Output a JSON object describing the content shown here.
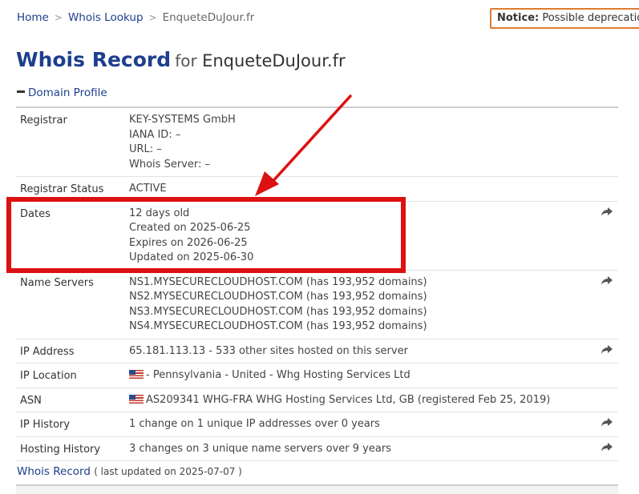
{
  "breadcrumb": {
    "home": "Home",
    "lookup": "Whois Lookup",
    "current": "EnqueteDuJour.fr"
  },
  "notice": {
    "label": "Notice:",
    "text": "Possible deprecation"
  },
  "title": {
    "main": "Whois Record",
    "for": "for",
    "domain": "EnqueteDuJour.fr"
  },
  "section": {
    "label": "Domain Profile"
  },
  "rows": [
    {
      "label": "Registrar",
      "lines": [
        "KEY-SYSTEMS GmbH",
        "IANA ID: –",
        "URL: –",
        "Whois Server: –"
      ],
      "share": false
    },
    {
      "label": "Registrar Status",
      "lines": [
        "ACTIVE"
      ],
      "share": false
    },
    {
      "label": "Dates",
      "lines": [
        "12 days old",
        "Created on 2025-06-25",
        "Expires on 2026-06-25",
        "Updated on 2025-06-30"
      ],
      "share": true
    },
    {
      "label": "Name Servers",
      "lines": [
        "NS1.MYSECURECLOUDHOST.COM (has 193,952 domains)",
        "NS2.MYSECURECLOUDHOST.COM (has 193,952 domains)",
        "NS3.MYSECURECLOUDHOST.COM (has 193,952 domains)",
        "NS4.MYSECURECLOUDHOST.COM (has 193,952 domains)"
      ],
      "share": true
    },
    {
      "label": "IP Address",
      "lines": [
        "65.181.113.13 - 533 other sites hosted on this server"
      ],
      "share": true
    },
    {
      "label": "IP Location",
      "lines": [
        "- Pennsylvania - United - Whg Hosting Services Ltd"
      ],
      "share": false,
      "flag": true
    },
    {
      "label": "ASN",
      "lines": [
        "AS209341 WHG-FRA WHG Hosting Services Ltd, GB (registered Feb 25, 2019)"
      ],
      "share": false,
      "flag": true
    },
    {
      "label": "IP History",
      "lines": [
        "1 change on 1 unique IP addresses over 0 years"
      ],
      "share": true
    },
    {
      "label": "Hosting History",
      "lines": [
        "3 changes on 3 unique name servers over 9 years"
      ],
      "share": true
    }
  ],
  "footer": {
    "link": "Whois Record",
    "sub": "( last updated on 2025-07-07 )"
  },
  "colors": {
    "link": "#1d3f8c",
    "highlight": "#dd1111",
    "notice_border": "#e07b2e"
  }
}
